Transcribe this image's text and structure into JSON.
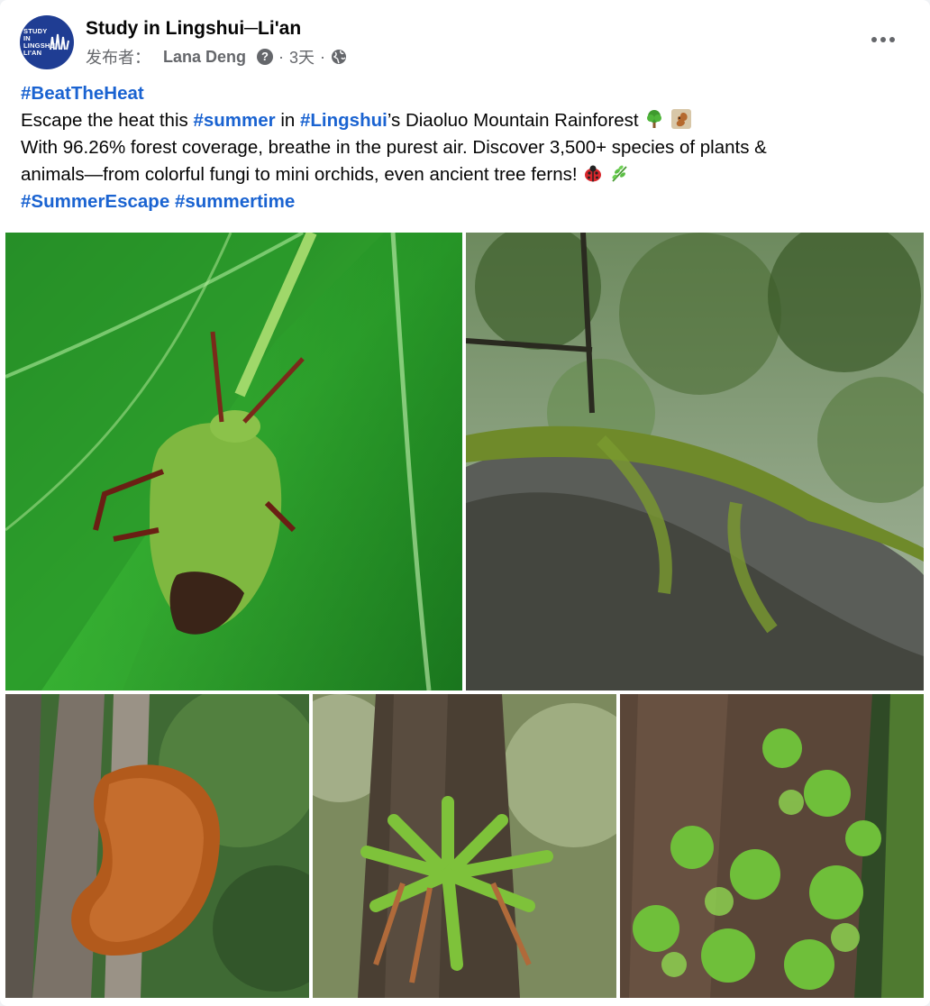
{
  "post": {
    "page_name": "Study in Lingshui─Li'an",
    "avatar_text": "STUDY IN LINGSHUI LI'AN",
    "meta": {
      "publisher_label": "发布者：",
      "author": "Lana Deng",
      "help_icon": "?",
      "dot": "·",
      "time": "3天",
      "audience_icon": "globe-icon"
    },
    "more_icon": "more-horizontal-icon",
    "text": {
      "hashtag_beat": "#BeatTheHeat",
      "l2_a": "Escape the heat this ",
      "hashtag_summer": "#summer",
      "l2_b": " in ",
      "hashtag_lingshui": "#Lingshui",
      "l2_c": "’s Diaoluo Mountain Rainforest",
      "l3": "With 96.26% forest coverage, breathe in the purest air. Discover 3,500+ species of plants &",
      "l4": "animals—from colorful fungi to mini orchids, even ancient tree ferns!",
      "hashtag_escape": "#SummerEscape",
      "space": " ",
      "hashtag_summertime": "#summertime"
    },
    "emojis": [
      "tree-emoji",
      "squirrel-emoji",
      "ladybug-emoji",
      "herb-emoji"
    ],
    "photos": [
      "green-shield-bug-photo",
      "mossy-branch-canopy-photo",
      "orange-bracket-fungus-photo",
      "orchid-on-tree-photo",
      "moss-covered-trunk-photo"
    ]
  },
  "colors": {
    "hashtag": "#1a63d1",
    "text": "#050505",
    "secondary": "#65676b",
    "avatar_bg": "#1f3d93"
  }
}
